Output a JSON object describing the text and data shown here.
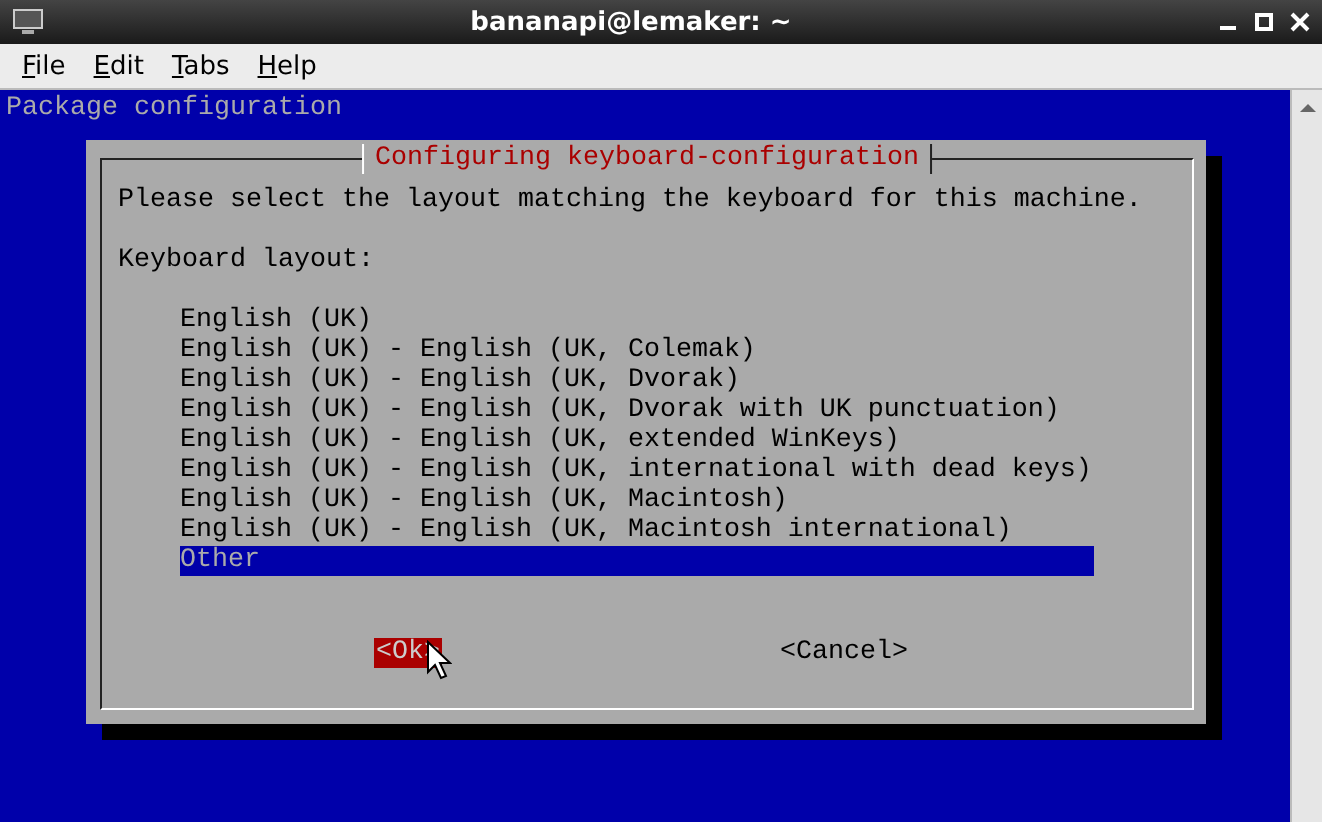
{
  "window": {
    "title": "bananapi@lemaker: ~"
  },
  "menu": [
    {
      "label": "File"
    },
    {
      "label": "Edit"
    },
    {
      "label": "Tabs"
    },
    {
      "label": "Help"
    }
  ],
  "terminal": {
    "header": "Package configuration",
    "dialog": {
      "title": "Configuring keyboard-configuration",
      "prompt": "Please select the layout matching the keyboard for this machine.",
      "list_label": "Keyboard layout:",
      "options": [
        {
          "label": "English (UK)",
          "selected": false
        },
        {
          "label": "English (UK) - English (UK, Colemak)",
          "selected": false
        },
        {
          "label": "English (UK) - English (UK, Dvorak)",
          "selected": false
        },
        {
          "label": "English (UK) - English (UK, Dvorak with UK punctuation)",
          "selected": false
        },
        {
          "label": "English (UK) - English (UK, extended WinKeys)",
          "selected": false
        },
        {
          "label": "English (UK) - English (UK, international with dead keys)",
          "selected": false
        },
        {
          "label": "English (UK) - English (UK, Macintosh)",
          "selected": false
        },
        {
          "label": "English (UK) - English (UK, Macintosh international)",
          "selected": false
        },
        {
          "label": "Other",
          "selected": true
        }
      ],
      "buttons": [
        {
          "label": "<Ok>",
          "selected": true
        },
        {
          "label": "<Cancel>",
          "selected": false
        }
      ]
    }
  }
}
